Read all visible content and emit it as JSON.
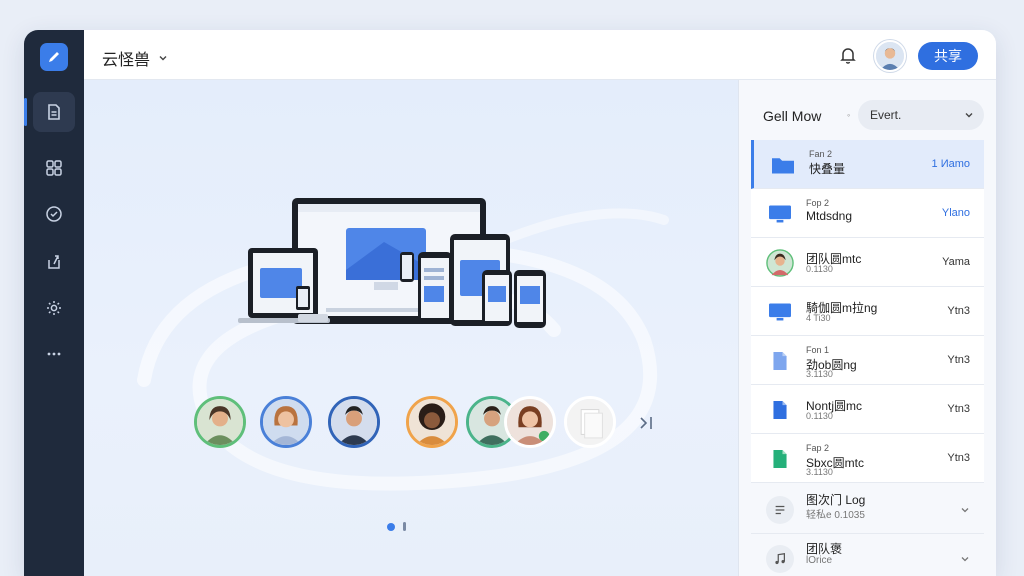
{
  "app": {
    "title": "云怪兽"
  },
  "header": {
    "primary_button": "共享"
  },
  "rail": {
    "items": [
      "files-icon",
      "apps-icon",
      "check-icon",
      "share-icon",
      "settings-icon",
      "more-icon"
    ]
  },
  "stage": {
    "carousel": {
      "page": 1,
      "pages": 2
    }
  },
  "panel": {
    "title": "Gell Mow",
    "separator": "◦",
    "filter": "Evert."
  },
  "rows": [
    {
      "icon": "folder-icon",
      "line1": "Fan 2",
      "line2": "快叠量",
      "line3": "",
      "right": "1 Иamo",
      "right_blue": true,
      "selected": true
    },
    {
      "icon": "monitor-icon",
      "line1": "Fop 2",
      "line2": "Mtdsdng",
      "line3": "",
      "right": "Ylano",
      "right_blue": true
    },
    {
      "icon": "avatar-icon",
      "line1": "",
      "line2": "团队圆mtc",
      "line3": "0.1130",
      "right": "Yama"
    },
    {
      "icon": "monitor-icon",
      "line1": "",
      "line2": "騎伽圆m拉ng",
      "line3": "4 Ti30",
      "right": "Ytn3"
    },
    {
      "icon": "doc-light-icon",
      "line1": "Fon 1",
      "line2": "劲ob圆ng",
      "line3": "3.1130",
      "right": "Ytn3"
    },
    {
      "icon": "doc-blue-icon",
      "line1": "",
      "line2": "Nontj圆mc",
      "line3": "0.1130",
      "right": "Ytn3"
    },
    {
      "icon": "doc-green-icon",
      "line1": "Fap 2",
      "line2": "Sbxc圆mtc",
      "line3": "3.1130",
      "right": "Ytn3"
    },
    {
      "icon": "list-icon",
      "line1": "",
      "line2": "图次门 Log",
      "line3": "轻私e 0.1035",
      "right": "",
      "chevron": true,
      "lower": true
    },
    {
      "icon": "music-icon",
      "line1": "",
      "line2": "团队褒",
      "line3": "lOrice",
      "right": "",
      "chevron": true,
      "lower": true
    }
  ],
  "colors": {
    "accent": "#3b7de9",
    "rail": "#1f2a3c",
    "button": "#2f6fe0"
  }
}
